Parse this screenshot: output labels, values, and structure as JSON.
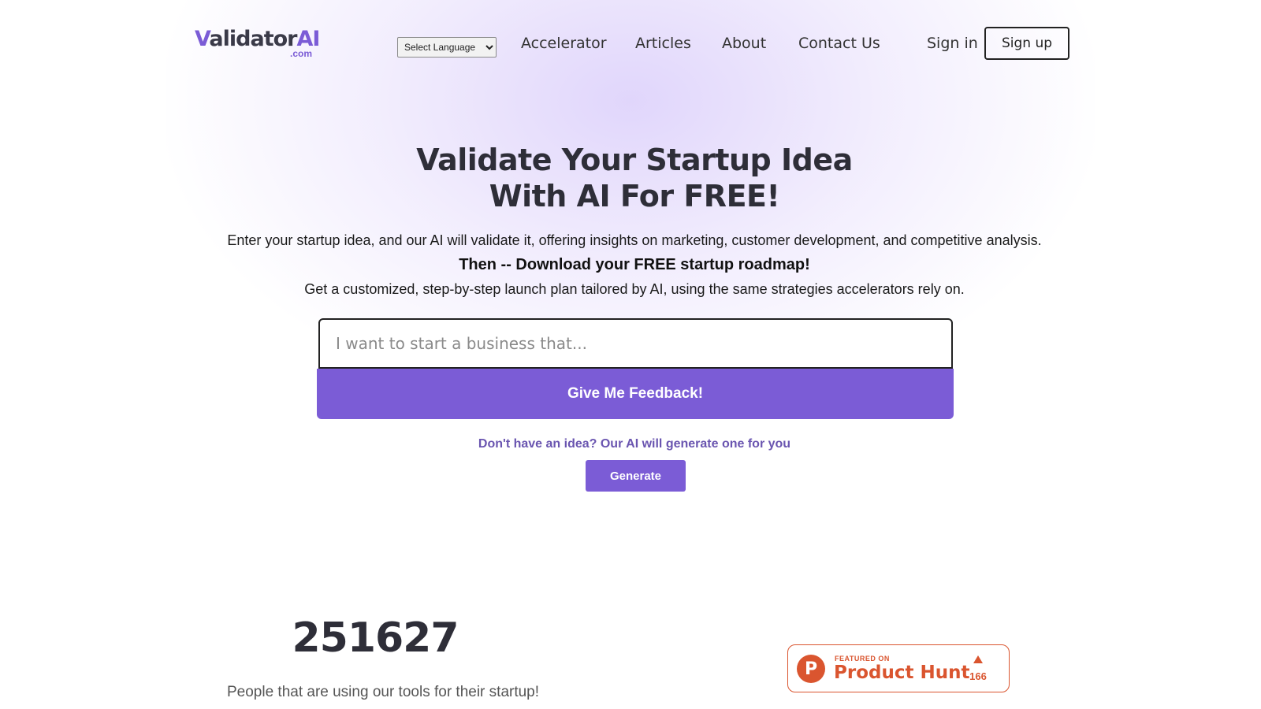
{
  "header": {
    "logo_text_v": "V",
    "logo_text_rest": "alidator",
    "logo_text_ai": "AI",
    "logo_sub": ".com",
    "language_select": "Select Language",
    "nav": [
      "Accelerator",
      "Articles",
      "About",
      "Contact Us"
    ],
    "signin_label": "Sign in",
    "signup_label": "Sign up"
  },
  "hero": {
    "title_line1": "Validate Your Startup Idea",
    "title_line2": "With AI For FREE!",
    "description": "Enter your startup idea, and our AI will validate it, offering insights on marketing, customer development, and competitive analysis.",
    "cta": "Then -- Download your FREE startup roadmap!",
    "subtext": "Get a customized, step-by-step launch plan tailored by AI, using the same strategies accelerators rely on.",
    "input_placeholder": "I want to start a business that...",
    "feedback_button": "Give Me Feedback!",
    "no_idea_text": "Don't have an idea? Our AI will generate one for you",
    "generate_button": "Generate"
  },
  "stats": {
    "users_count": "251627",
    "users_label": "People that are using our tools for their startup!"
  },
  "product_hunt": {
    "featured_label": "FEATURED ON",
    "name": "Product Hunt",
    "logo_letter": "P",
    "upvotes": "166"
  },
  "colors": {
    "accent": "#7b5cd6",
    "product_hunt": "#da552f"
  }
}
